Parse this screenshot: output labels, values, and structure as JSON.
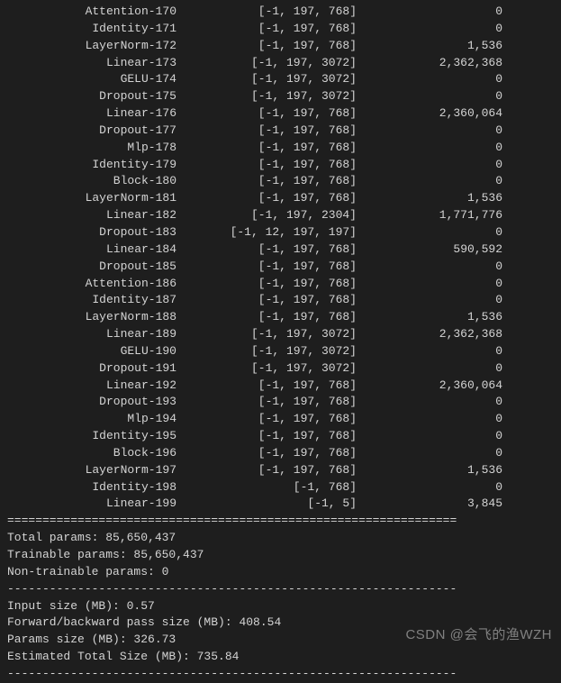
{
  "layers": [
    {
      "name": "Attention-170",
      "shape": "[-1, 197, 768]",
      "params": "0"
    },
    {
      "name": "Identity-171",
      "shape": "[-1, 197, 768]",
      "params": "0"
    },
    {
      "name": "LayerNorm-172",
      "shape": "[-1, 197, 768]",
      "params": "1,536"
    },
    {
      "name": "Linear-173",
      "shape": "[-1, 197, 3072]",
      "params": "2,362,368"
    },
    {
      "name": "GELU-174",
      "shape": "[-1, 197, 3072]",
      "params": "0"
    },
    {
      "name": "Dropout-175",
      "shape": "[-1, 197, 3072]",
      "params": "0"
    },
    {
      "name": "Linear-176",
      "shape": "[-1, 197, 768]",
      "params": "2,360,064"
    },
    {
      "name": "Dropout-177",
      "shape": "[-1, 197, 768]",
      "params": "0"
    },
    {
      "name": "Mlp-178",
      "shape": "[-1, 197, 768]",
      "params": "0"
    },
    {
      "name": "Identity-179",
      "shape": "[-1, 197, 768]",
      "params": "0"
    },
    {
      "name": "Block-180",
      "shape": "[-1, 197, 768]",
      "params": "0"
    },
    {
      "name": "LayerNorm-181",
      "shape": "[-1, 197, 768]",
      "params": "1,536"
    },
    {
      "name": "Linear-182",
      "shape": "[-1, 197, 2304]",
      "params": "1,771,776"
    },
    {
      "name": "Dropout-183",
      "shape": "[-1, 12, 197, 197]",
      "params": "0"
    },
    {
      "name": "Linear-184",
      "shape": "[-1, 197, 768]",
      "params": "590,592"
    },
    {
      "name": "Dropout-185",
      "shape": "[-1, 197, 768]",
      "params": "0"
    },
    {
      "name": "Attention-186",
      "shape": "[-1, 197, 768]",
      "params": "0"
    },
    {
      "name": "Identity-187",
      "shape": "[-1, 197, 768]",
      "params": "0"
    },
    {
      "name": "LayerNorm-188",
      "shape": "[-1, 197, 768]",
      "params": "1,536"
    },
    {
      "name": "Linear-189",
      "shape": "[-1, 197, 3072]",
      "params": "2,362,368"
    },
    {
      "name": "GELU-190",
      "shape": "[-1, 197, 3072]",
      "params": "0"
    },
    {
      "name": "Dropout-191",
      "shape": "[-1, 197, 3072]",
      "params": "0"
    },
    {
      "name": "Linear-192",
      "shape": "[-1, 197, 768]",
      "params": "2,360,064"
    },
    {
      "name": "Dropout-193",
      "shape": "[-1, 197, 768]",
      "params": "0"
    },
    {
      "name": "Mlp-194",
      "shape": "[-1, 197, 768]",
      "params": "0"
    },
    {
      "name": "Identity-195",
      "shape": "[-1, 197, 768]",
      "params": "0"
    },
    {
      "name": "Block-196",
      "shape": "[-1, 197, 768]",
      "params": "0"
    },
    {
      "name": "LayerNorm-197",
      "shape": "[-1, 197, 768]",
      "params": "1,536"
    },
    {
      "name": "Identity-198",
      "shape": "[-1, 768]",
      "params": "0"
    },
    {
      "name": "Linear-199",
      "shape": "[-1, 5]",
      "params": "3,845"
    }
  ],
  "divider_eq": "================================================================",
  "divider_dash": "----------------------------------------------------------------",
  "summary": {
    "total_params": "Total params: 85,650,437",
    "trainable_params": "Trainable params: 85,650,437",
    "non_trainable_params": "Non-trainable params: 0",
    "input_size": "Input size (MB): 0.57",
    "fwd_bwd_size": "Forward/backward pass size (MB): 408.54",
    "params_size": "Params size (MB): 326.73",
    "est_total": "Estimated Total Size (MB): 735.84"
  },
  "watermark": "CSDN @会飞的渔WZH"
}
